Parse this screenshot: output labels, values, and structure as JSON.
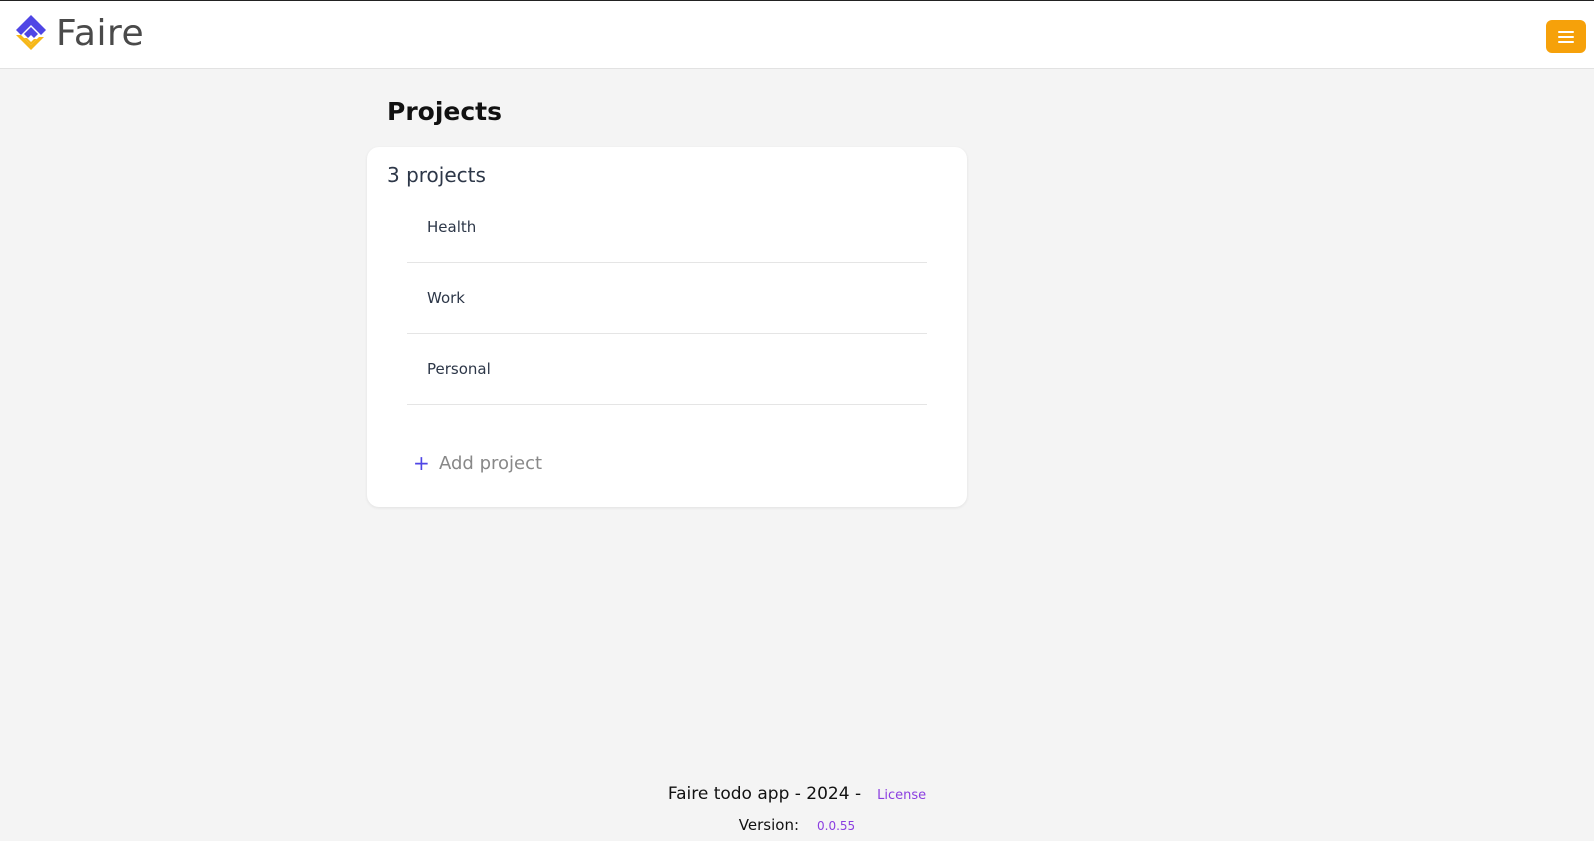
{
  "header": {
    "logo_text": "Faire",
    "logo_icon": "faire-logo-icon",
    "menu_icon": "hamburger-menu-icon",
    "colors": {
      "menu_button": "#f6a10a",
      "logo_blue": "#4f46e5",
      "logo_yellow": "#f6b81a"
    }
  },
  "main": {
    "title": "Projects",
    "count_label": "3 projects",
    "projects": [
      {
        "name": "Health"
      },
      {
        "name": "Work"
      },
      {
        "name": "Personal"
      }
    ],
    "add_project_label": "Add project",
    "add_icon": "plus-icon"
  },
  "footer": {
    "text": "Faire todo app - 2024 -",
    "license_label": "License",
    "version_label": "Version:",
    "version_value": "0.0.55",
    "accent_color": "#8b3ee0"
  }
}
